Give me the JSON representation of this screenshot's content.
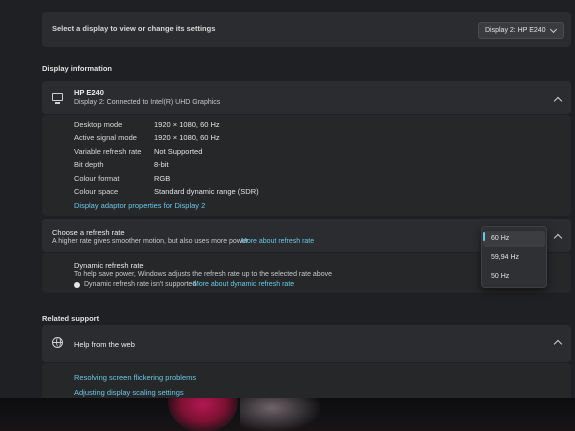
{
  "select_display": {
    "prompt": "Select a display to view or change its settings",
    "dropdown_value": "Display 2: HP E240"
  },
  "display_information": {
    "section_title": "Display information",
    "monitor_name": "HP E240",
    "monitor_subtitle": "Display 2: Connected to Intel(R) UHD Graphics",
    "rows": [
      {
        "label": "Desktop mode",
        "value": "1920 × 1080, 60 Hz"
      },
      {
        "label": "Active signal mode",
        "value": "1920 × 1080, 60 Hz"
      },
      {
        "label": "Variable refresh rate",
        "value": "Not Supported"
      },
      {
        "label": "Bit depth",
        "value": "8-bit"
      },
      {
        "label": "Colour format",
        "value": "RGB"
      },
      {
        "label": "Colour space",
        "value": "Standard dynamic range (SDR)"
      }
    ],
    "adaptor_link": "Display adaptor properties for Display 2"
  },
  "refresh_rate": {
    "title": "Choose a refresh rate",
    "description": "A higher rate gives smoother motion, but also uses more power",
    "more_link": "More about refresh rate",
    "options": [
      "60 Hz",
      "59,94 Hz",
      "50 Hz"
    ],
    "selected": "60 Hz",
    "dynamic_title": "Dynamic refresh rate",
    "dynamic_description": "To help save power, Windows adjusts the refresh rate up to the selected rate above",
    "dynamic_status": "Dynamic refresh rate isn't supported",
    "dynamic_link": "More about dynamic refresh rate"
  },
  "related_support": {
    "section_title": "Related support",
    "help_title": "Help from the web",
    "links": [
      "Resolving screen flickering problems",
      "Adjusting display scaling settings"
    ]
  },
  "colors": {
    "accent": "#6cc6e8",
    "background": "#1f2023",
    "card": "#2b2c2f"
  }
}
